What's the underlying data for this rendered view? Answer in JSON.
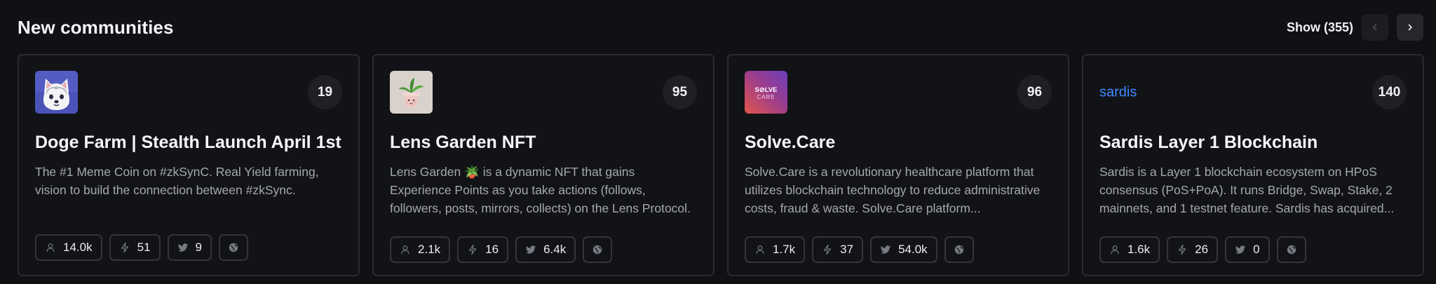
{
  "header": {
    "title": "New communities",
    "show_label": "Show (355)"
  },
  "cards": [
    {
      "count": "19",
      "name": "Doge Farm | Stealth Launch April 1st",
      "description": "The #1 Meme Coin on #zkSynC. Real Yield farming, vision to build the connection between #zkSync.",
      "members": "14.0k",
      "activity": "51",
      "twitter": "9",
      "logo": "doge-farm-logo"
    },
    {
      "count": "95",
      "name": "Lens Garden NFT",
      "description": "Lens Garden 🪴 is a dynamic NFT that gains Experience Points as you take actions (follows, followers, posts, mirrors, collects) on the Lens Protocol.",
      "members": "2.1k",
      "activity": "16",
      "twitter": "6.4k",
      "logo": "lens-garden-logo"
    },
    {
      "count": "96",
      "name": "Solve.Care",
      "description": "Solve.Care is a revolutionary healthcare platform that utilizes blockchain technology to reduce administrative costs, fraud & waste. Solve.Care platform...",
      "members": "1.7k",
      "activity": "37",
      "twitter": "54.0k",
      "logo": "solve-care-logo",
      "logo_text_top": "S⊘LVE",
      "logo_text_bottom": "CARE"
    },
    {
      "count": "140",
      "name": "Sardis Layer 1 Blockchain",
      "description": "Sardis is a Layer 1 blockchain ecosystem on HPoS consensus (PoS+PoA). It runs Bridge, Swap, Stake, 2 mainnets, and 1 testnet feature. Sardis has acquired...",
      "members": "1.6k",
      "activity": "26",
      "twitter": "0",
      "logo": "sardis-logo",
      "logo_text": "sardis"
    }
  ],
  "colors": {
    "background": "#101115",
    "card_border": "#2a2b31",
    "sardis_blue": "#3d8bff"
  }
}
